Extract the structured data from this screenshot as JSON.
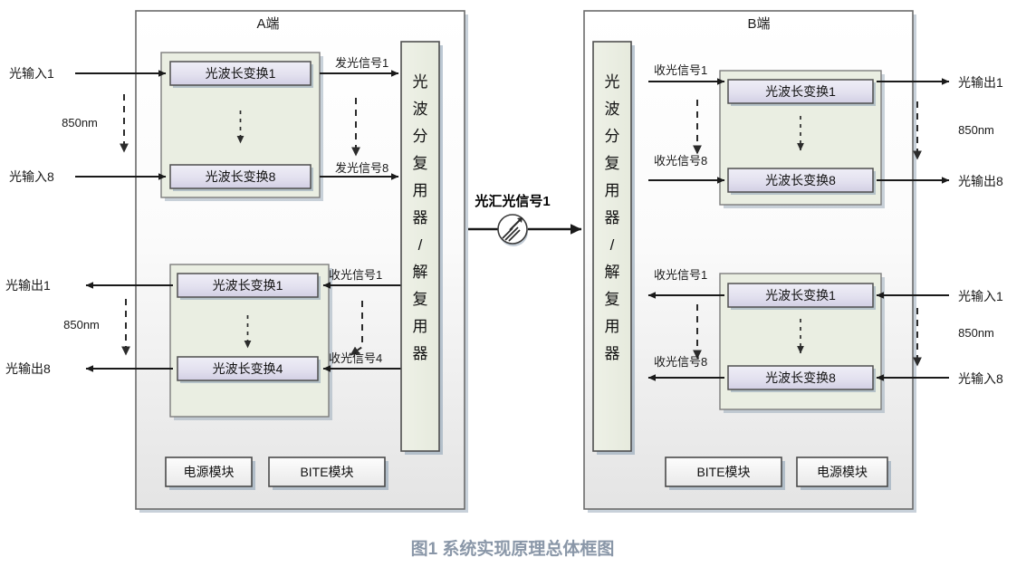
{
  "figure": {
    "caption": "图1 系统实现原理总体框图"
  },
  "panels": [
    {
      "id": "a-end",
      "title": "A端",
      "tx_group": {
        "converters": [
          "光波长变换1",
          "光波长变换8"
        ],
        "in_labels": [
          "光输入1",
          "光输入8"
        ],
        "in_range": "850nm",
        "out_labels": [
          "发光信号1",
          "发光信号8"
        ]
      },
      "rx_group": {
        "converters": [
          "光波长变换1",
          "光波长变换4"
        ],
        "out_labels": [
          "光输出1",
          "光输出8"
        ],
        "out_range": "850nm",
        "in_labels": [
          "收光信号1",
          "收光信号4"
        ]
      },
      "mux_label": "光波分复用器／解复用器",
      "mux_chars": [
        "光",
        "波",
        "分",
        "复",
        "用",
        "器",
        "/",
        "解",
        "复",
        "用",
        "器"
      ],
      "modules": [
        "电源模块",
        "BITE模块"
      ]
    },
    {
      "id": "b-end",
      "title": "B端",
      "mux_label": "光波分复用器／解复用器",
      "mux_chars": [
        "光",
        "波",
        "分",
        "复",
        "用",
        "器",
        "/",
        "解",
        "复",
        "用",
        "器"
      ],
      "rx_group": {
        "converters": [
          "光波长变换1",
          "光波长变换8"
        ],
        "in_labels": [
          "收光信号1",
          "收光信号8"
        ],
        "out_labels": [
          "光输出1",
          "光输出8"
        ],
        "out_range": "850nm"
      },
      "tx_group": {
        "converters": [
          "光波长变换1",
          "光波长变换8"
        ],
        "out_labels": [
          "收光信号1",
          "收光信号8"
        ],
        "in_labels": [
          "光输入1",
          "光输入8"
        ],
        "in_range": "850nm"
      },
      "modules": [
        "BITE模块",
        "电源模块"
      ]
    }
  ],
  "link": {
    "label": "光汇光信号1",
    "icon": "optical-fiber-icon"
  },
  "colors": {
    "panel_fill_top": "#ffffff",
    "panel_fill_bottom": "#e6e6e6",
    "panel_border": "#6b6b6b",
    "group_fill": "#eaeee2",
    "group_border": "#7d7d7d",
    "converter_fill_top": "#e7e6f2",
    "converter_fill_bottom": "#d7d5e8",
    "converter_border": "#5a5a5a",
    "mux_fill": "#ebeee3",
    "module_fill": "#f4f4f4",
    "shadow": "#8fa3b5",
    "wire": "#1a1a1a",
    "caption": "#8a97a8"
  }
}
